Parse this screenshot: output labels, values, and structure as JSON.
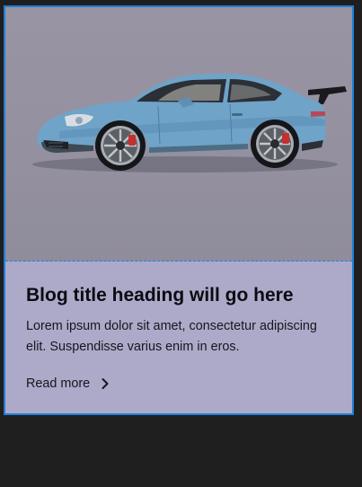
{
  "card": {
    "image_subject": "car-image",
    "title": "Blog title heading will go here",
    "excerpt": "Lorem ipsum dolor sit amet, consectetur adipiscing elit. Suspendisse varius enim in eros.",
    "cta_label": "Read more",
    "cta_icon": "chevron-right-icon"
  },
  "colors": {
    "page_background": "#1f1f1f",
    "card_background": "#adaac9",
    "image_background": "#9894a4",
    "selection_outline": "#1e7fd8",
    "car_body": "#6fa3c8",
    "heading_text": "#0b0b12"
  }
}
